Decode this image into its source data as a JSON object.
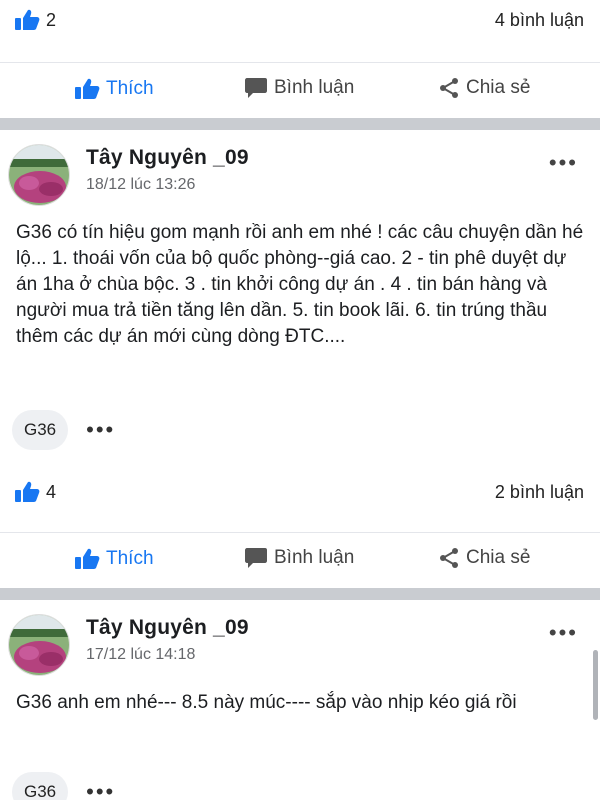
{
  "top_reactions": {
    "like_count": "2",
    "comment_count": "4 bình luận"
  },
  "actions": {
    "like": "Thích",
    "comment": "Bình luận",
    "share": "Chia sẻ"
  },
  "posts": [
    {
      "author": "Tây Nguyên _09",
      "timestamp": "18/12 lúc 13:26",
      "text": "G36 có tín hiệu gom mạnh rồi anh em nhé ! các câu chuyện dần hé lộ... 1. thoái vốn của bộ quốc phòng--giá cao.  2 - tin phê duyệt dự án 1ha ở chùa bộc.  3 . tin khởi công dự án .  4 . tin bán hàng và người mua trả tiền tăng lên dần.  5. tin book lãi.  6. tin trúng thầu thêm các dự án mới cùng dòng ĐTC....",
      "tag": "G36",
      "like_count": "4",
      "comment_count": "2 bình luận"
    },
    {
      "author": "Tây Nguyên _09",
      "timestamp": "17/12 lúc 14:18",
      "text": "G36 anh em nhé--- 8.5 này múc---- sắp vào nhịp kéo giá rồi",
      "tag": "G36"
    }
  ],
  "colors": {
    "brand_blue": "#1877f2",
    "separator": "#c9ccd1",
    "muted_text": "#65676b"
  },
  "icons": [
    "thumbs-up-icon",
    "comment-bubble-icon",
    "share-icon",
    "more-dots-icon"
  ]
}
